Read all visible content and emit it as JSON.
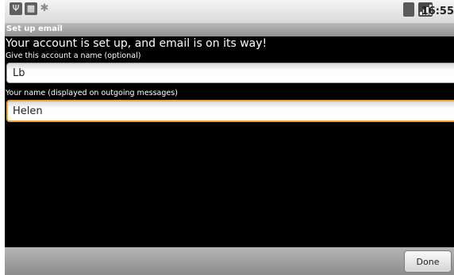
{
  "status_bar": {
    "left_icons": [
      "usb-icon",
      "android-debug-icon",
      "bluetooth-icon"
    ],
    "right_icons": [
      "battery-icon",
      "signal-icon"
    ],
    "time": "16:55"
  },
  "title_bar": {
    "title": "Set up email"
  },
  "main": {
    "headline": "Your account is set up, and email is on its way!",
    "account_name": {
      "label": "Give this account a name (optional)",
      "value": "Lb"
    },
    "your_name": {
      "label": "Your name (displayed on outgoing messages)",
      "value": "Helen"
    }
  },
  "bottom_bar": {
    "done_label": "Done"
  },
  "colors": {
    "focus_accent": "#f2a532",
    "content_background": "#000000",
    "bar_gray": "#a4a4a4"
  }
}
